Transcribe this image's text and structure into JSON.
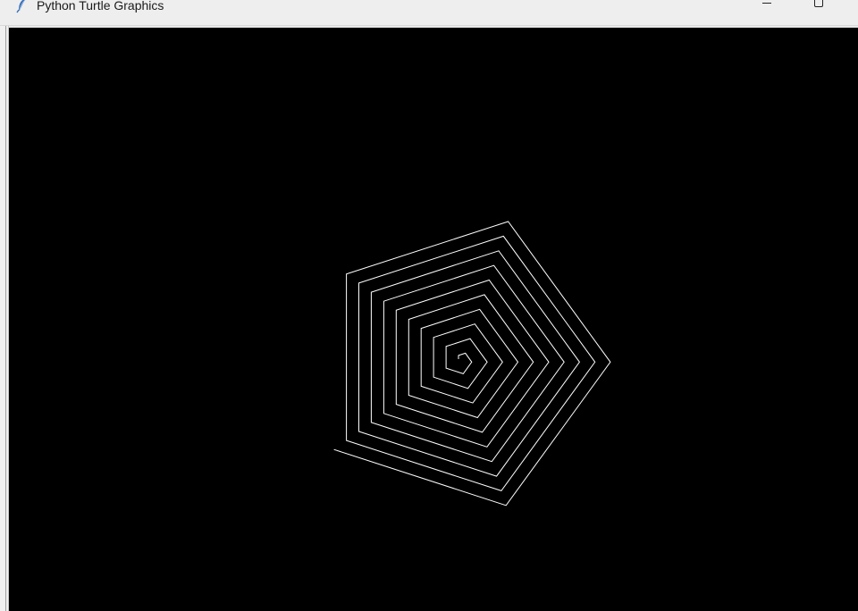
{
  "window": {
    "title": "Python Turtle Graphics",
    "icon": "feather-icon",
    "controls": {
      "minimize": "minimize-icon",
      "maximize": "maximize-icon"
    }
  },
  "canvas": {
    "background": "#000000",
    "line_color": "#ffffff",
    "shape": "pentagon spiral"
  }
}
